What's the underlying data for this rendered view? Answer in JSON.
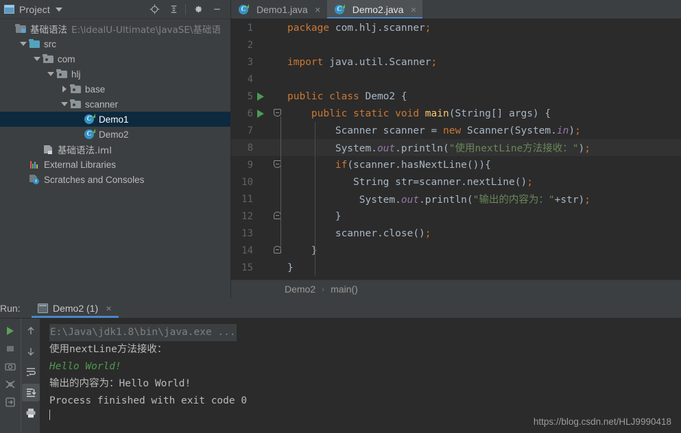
{
  "project_panel": {
    "title": "Project",
    "icons": [
      "locate-icon",
      "collapse-all-icon",
      "settings-gear-icon",
      "minimize-icon"
    ],
    "tree": [
      {
        "label": "基础语法",
        "path": "E:\\idealU-Ultimate\\JavaSE\\基础语",
        "icon": "module-icon",
        "indent": 0,
        "twisty": "none",
        "selected": false
      },
      {
        "label": "src",
        "path": "",
        "icon": "source-folder-icon",
        "indent": 1,
        "twisty": "down",
        "selected": false
      },
      {
        "label": "com",
        "path": "",
        "icon": "package-folder-icon",
        "indent": 2,
        "twisty": "down",
        "selected": false
      },
      {
        "label": "hlj",
        "path": "",
        "icon": "package-folder-icon",
        "indent": 3,
        "twisty": "down",
        "selected": false
      },
      {
        "label": "base",
        "path": "",
        "icon": "package-folder-icon",
        "indent": 4,
        "twisty": "right",
        "selected": false
      },
      {
        "label": "scanner",
        "path": "",
        "icon": "package-folder-icon",
        "indent": 4,
        "twisty": "down",
        "selected": false
      },
      {
        "label": "Demo1",
        "path": "",
        "icon": "java-class-icon",
        "indent": 5,
        "twisty": "none",
        "selected": true
      },
      {
        "label": "Demo2",
        "path": "",
        "icon": "java-class-icon",
        "indent": 5,
        "twisty": "none",
        "selected": false
      },
      {
        "label": "基础语法.iml",
        "path": "",
        "icon": "iml-file-icon",
        "indent": 2,
        "twisty": "none",
        "selected": false
      },
      {
        "label": "External Libraries",
        "path": "",
        "icon": "external-libraries-icon",
        "indent": 1,
        "twisty": "none",
        "selected": false
      },
      {
        "label": "Scratches and Consoles",
        "path": "",
        "icon": "scratches-icon",
        "indent": 1,
        "twisty": "none",
        "selected": false
      }
    ]
  },
  "editor": {
    "tabs": [
      {
        "label": "Demo1.java",
        "active": false,
        "close": "×"
      },
      {
        "label": "Demo2.java",
        "active": true,
        "close": "×"
      }
    ],
    "current_line": 8,
    "lines": [
      {
        "n": "1",
        "run": false,
        "fold": "",
        "html": "<span class=\"kw\">package</span> com.hlj.scanner<span class=\"semi\">;</span>",
        "indent": 0
      },
      {
        "n": "2",
        "run": false,
        "fold": "",
        "html": "",
        "indent": 0
      },
      {
        "n": "3",
        "run": false,
        "fold": "",
        "html": "<span class=\"kw\">import</span> java.util.Scanner<span class=\"semi\">;</span>",
        "indent": 0
      },
      {
        "n": "4",
        "run": false,
        "fold": "",
        "html": "",
        "indent": 0
      },
      {
        "n": "5",
        "run": true,
        "fold": "",
        "html": "<span class=\"kw\">public class</span> Demo2 {",
        "indent": 0
      },
      {
        "n": "6",
        "run": true,
        "fold": "open",
        "html": "    <span class=\"kw\">public static void</span> <span class=\"fn\">main</span>(String[] args) {",
        "indent": 1
      },
      {
        "n": "7",
        "run": false,
        "fold": "",
        "html": "        Scanner scanner = <span class=\"kw\">new</span> Scanner(System.<span class=\"fld\">in</span>)<span class=\"semi\">;</span>",
        "indent": 1
      },
      {
        "n": "8",
        "run": false,
        "fold": "",
        "html": "        System.<span class=\"fld\">out</span>.println(<span class=\"str\">\"使用nextLine方法接收：\"</span>)<span class=\"semi\">;</span>",
        "indent": 1
      },
      {
        "n": "9",
        "run": false,
        "fold": "open",
        "html": "        <span class=\"kw\">if</span>(scanner.hasNextLine()){",
        "indent": 1
      },
      {
        "n": "10",
        "run": false,
        "fold": "",
        "html": "           String str=scanner.nextLine()<span class=\"semi\">;</span>",
        "indent": 1
      },
      {
        "n": "11",
        "run": false,
        "fold": "",
        "html": "            System.<span class=\"fld\">out</span>.println(<span class=\"str\">\"输出的内容为：\"</span>+str)<span class=\"semi\">;</span>",
        "indent": 1
      },
      {
        "n": "12",
        "run": false,
        "fold": "end",
        "html": "        }",
        "indent": 1
      },
      {
        "n": "13",
        "run": false,
        "fold": "",
        "html": "        scanner.close()<span class=\"semi\">;</span>",
        "indent": 1
      },
      {
        "n": "14",
        "run": false,
        "fold": "end",
        "html": "    }",
        "indent": 1
      },
      {
        "n": "15",
        "run": false,
        "fold": "",
        "html": "}",
        "indent": 0
      }
    ],
    "breadcrumb": {
      "class": "Demo2",
      "separator": "›",
      "method": "main()"
    }
  },
  "run_panel": {
    "label": "Run:",
    "tab": {
      "label": "Demo2 (1)",
      "close": "×",
      "active": true
    },
    "toolbar_left": [
      "rerun-icon",
      "stop-icon",
      "camera-icon",
      "thread-dump-icon",
      "export-icon"
    ],
    "toolbar_side": [
      "up-arrow-icon",
      "down-arrow-icon",
      "soft-wrap-icon",
      "scroll-to-end-icon",
      "print-icon"
    ],
    "console": [
      {
        "text": "E:\\Java\\jdk1.8\\bin\\java.exe ...",
        "type": "cmd"
      },
      {
        "text": "使用nextLine方法接收：",
        "type": "out"
      },
      {
        "text": "Hello World!",
        "type": "in"
      },
      {
        "text": "输出的内容为：Hello World!",
        "type": "out"
      },
      {
        "text": "",
        "type": "out"
      },
      {
        "text": "Process finished with exit code 0",
        "type": "out"
      }
    ]
  },
  "watermark": "https://blog.csdn.net/HLJ9990418",
  "colors": {
    "panel_bg": "#3c3f41",
    "editor_bg": "#2b2b2b",
    "accent_blue": "#4a88c7",
    "selection_blue": "#0d293e",
    "keyword_orange": "#cc7832",
    "string_green": "#6a8759",
    "method_yellow": "#ffc66d",
    "field_purple": "#9876aa",
    "text_default": "#a9b7c6",
    "run_green": "#499c54"
  }
}
